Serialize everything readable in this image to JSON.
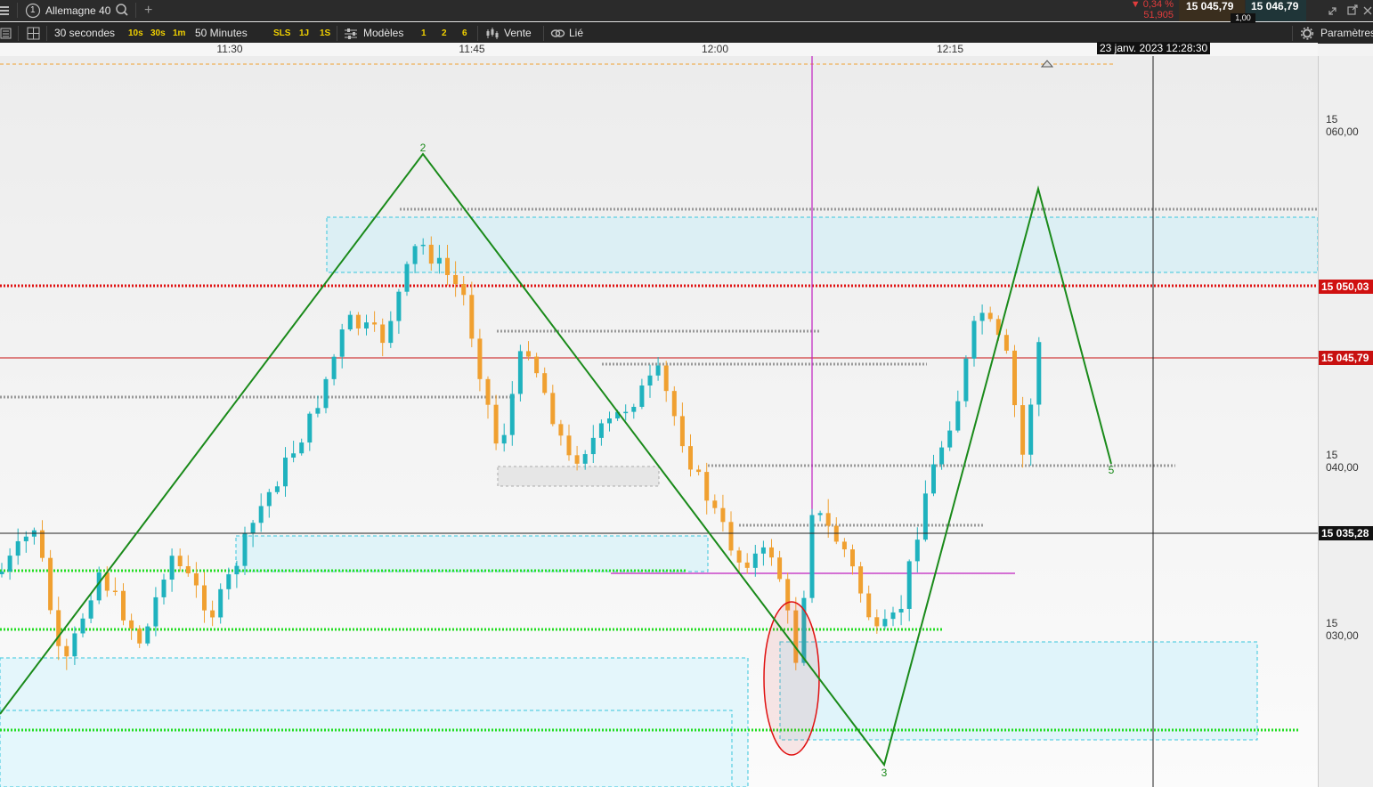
{
  "header": {
    "instrument_number": "1",
    "instrument": "Allemagne 40",
    "change_percent": "▼ 0,34 %",
    "change_points": "51,905",
    "bid": "15 045,79",
    "ask": "15 046,79",
    "spread": "1,00"
  },
  "toolbar": {
    "period": "30 secondes",
    "p10s": "10s",
    "p30s": "30s",
    "p1m": "1m",
    "range": "50 Minutes",
    "sls": "SLS",
    "r1j": "1J",
    "r1s": "1S",
    "models": "Modèles",
    "q1": "1",
    "q2": "2",
    "q6": "6",
    "sell": "Vente",
    "linked": "Lié",
    "settings": "Paramètres"
  },
  "time_axis": {
    "ticks": [
      "11:30",
      "11:45",
      "12:00",
      "12:15"
    ],
    "cursor_date": "23 janv. 2023 12:28:30"
  },
  "price_axis": {
    "labels": [
      "15 060,00",
      "15 040,00",
      "15 030,00"
    ],
    "resistance_tag": "15 050,03",
    "current_tag": "15 045,79",
    "crosshair_tag": "15 035,28"
  },
  "wave_labels": {
    "w2": "2",
    "w3": "3",
    "w5": "5"
  },
  "colors": {
    "bull": "#1fb2be",
    "bear": "#f0a030",
    "wave": "#1a8a1a",
    "resistance": "#e01010",
    "support": "#22dd22",
    "current": "#c81010",
    "zone": "#d7f3f8",
    "zone_border": "#38c6dc"
  },
  "icons": {
    "menu": "hamburger-menu-icon",
    "search": "search-icon",
    "add": "plus-icon",
    "layout": "layout-grid-icon",
    "models": "sliders-icon",
    "sell": "candles-icon",
    "linked": "link-icon",
    "settings": "gear-icon",
    "expand": "expand-icon",
    "popout": "popout-icon",
    "close": "close-icon"
  }
}
